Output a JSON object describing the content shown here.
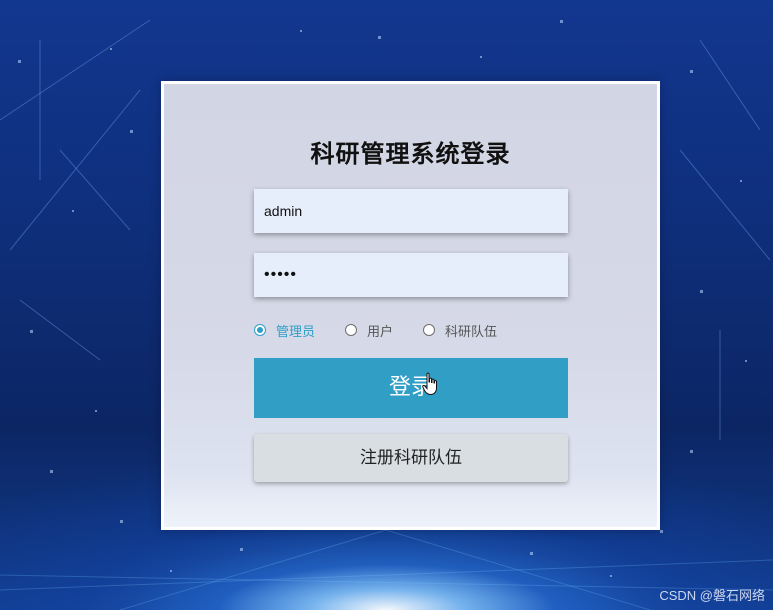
{
  "title": "科研管理系统登录",
  "username_field": {
    "value": "admin",
    "placeholder": ""
  },
  "password_field": {
    "value": "•••••",
    "placeholder": ""
  },
  "role_options": [
    {
      "label": "管理员",
      "checked": true
    },
    {
      "label": "用户",
      "checked": false
    },
    {
      "label": "科研队伍",
      "checked": false
    }
  ],
  "login_button": {
    "label": "登录"
  },
  "register_button": {
    "label": "注册科研队伍"
  },
  "watermark": "CSDN @磐石网络",
  "colors": {
    "accent": "#319ec6",
    "card_bg": "#d3d6e4",
    "input_bg": "#e6eefb",
    "register_bg": "#d9dee3",
    "background": "#0f2f7c"
  },
  "icons": {
    "cursor": "hand-pointer-icon"
  }
}
